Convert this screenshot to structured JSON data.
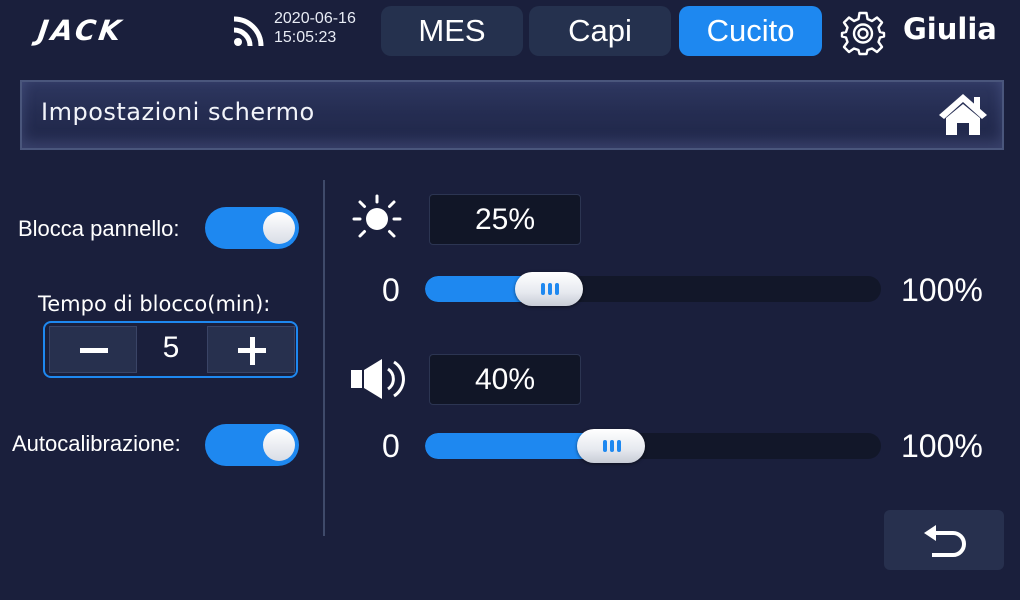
{
  "header": {
    "logo": "JACK",
    "date": "2020-06-16",
    "time": "15:05:23",
    "tabs": [
      {
        "label": "MES",
        "active": false
      },
      {
        "label": "Capi",
        "active": false
      },
      {
        "label": "Cucito",
        "active": true
      }
    ],
    "user": "Giulia"
  },
  "page": {
    "title": "Impostazioni schermo"
  },
  "left": {
    "lock_panel_label": "Blocca pannello:",
    "lock_panel_on": true,
    "lock_time_label": "Tempo di blocco(min):",
    "lock_time_value": "5",
    "autocal_label": "Autocalibrazione:",
    "autocal_on": true
  },
  "brightness": {
    "icon": "sun-icon",
    "value_text": "25%",
    "level_percent": 25,
    "min_label": "0",
    "max_label": "100%"
  },
  "volume": {
    "icon": "speaker-icon",
    "value_text": "40%",
    "level_percent": 40,
    "min_label": "0",
    "max_label": "100%"
  },
  "colors": {
    "accent": "#1e88f0",
    "background": "#1a1f3c",
    "button": "#27304e"
  }
}
